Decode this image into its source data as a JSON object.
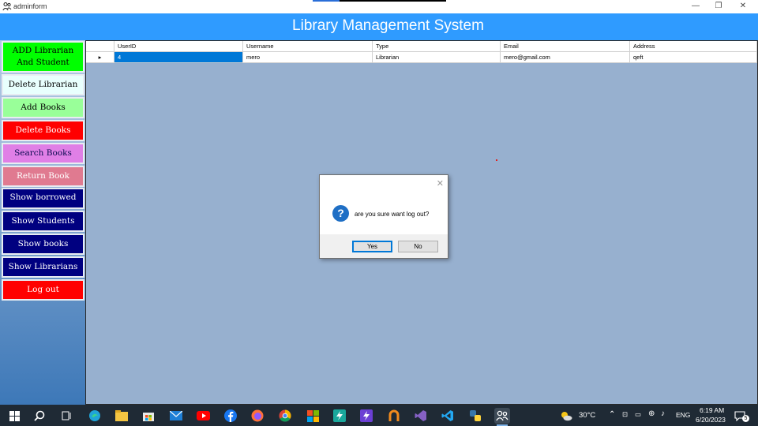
{
  "window": {
    "title": "adminform"
  },
  "header": {
    "title": "Library Management System"
  },
  "sidebar": {
    "items": [
      {
        "label": "ADD Librarian And Student",
        "bg": "#00ff00",
        "color": "#000000"
      },
      {
        "label": "Delete Librarian",
        "bg": "#e8fffd",
        "color": "#000000"
      },
      {
        "label": "Add Books",
        "bg": "#99ff99",
        "color": "#000000"
      },
      {
        "label": "Delete Books",
        "bg": "#ff0000",
        "color": "#ffffff"
      },
      {
        "label": "Search Books",
        "bg": "#e07fe6",
        "color": "#0a0a50"
      },
      {
        "label": "Return Book",
        "bg": "#e07a90",
        "color": "#ffffff"
      },
      {
        "label": "Show borrowed",
        "bg": "#000080",
        "color": "#ffffff"
      },
      {
        "label": "Show Students",
        "bg": "#000080",
        "color": "#ffffff"
      },
      {
        "label": "Show books",
        "bg": "#000080",
        "color": "#ffffff"
      },
      {
        "label": "Show Librarians",
        "bg": "#000080",
        "color": "#ffffff"
      },
      {
        "label": "Log out",
        "bg": "#ff0000",
        "color": "#ffffff"
      }
    ]
  },
  "grid": {
    "columns": [
      "UserID",
      "Username",
      "Type",
      "Email",
      "Address"
    ],
    "rows": [
      {
        "row_marker": "▸",
        "cells": [
          "4",
          "mero",
          "Librarian",
          "mero@gmail.com",
          "qeft"
        ]
      }
    ]
  },
  "dialog": {
    "message": "are you sure want log out?",
    "yes_label": "Yes",
    "no_label": "No",
    "close_glyph": "✕"
  },
  "taskbar": {
    "weather": "30°C",
    "language": "ENG",
    "time": "6:19 AM",
    "date": "6/20/2023",
    "notification_count": "5"
  },
  "colors": {
    "header": "#2f9bff",
    "main_bg": "#97b0cf",
    "selection": "#0078d7",
    "taskbar": "#1f2a35"
  }
}
